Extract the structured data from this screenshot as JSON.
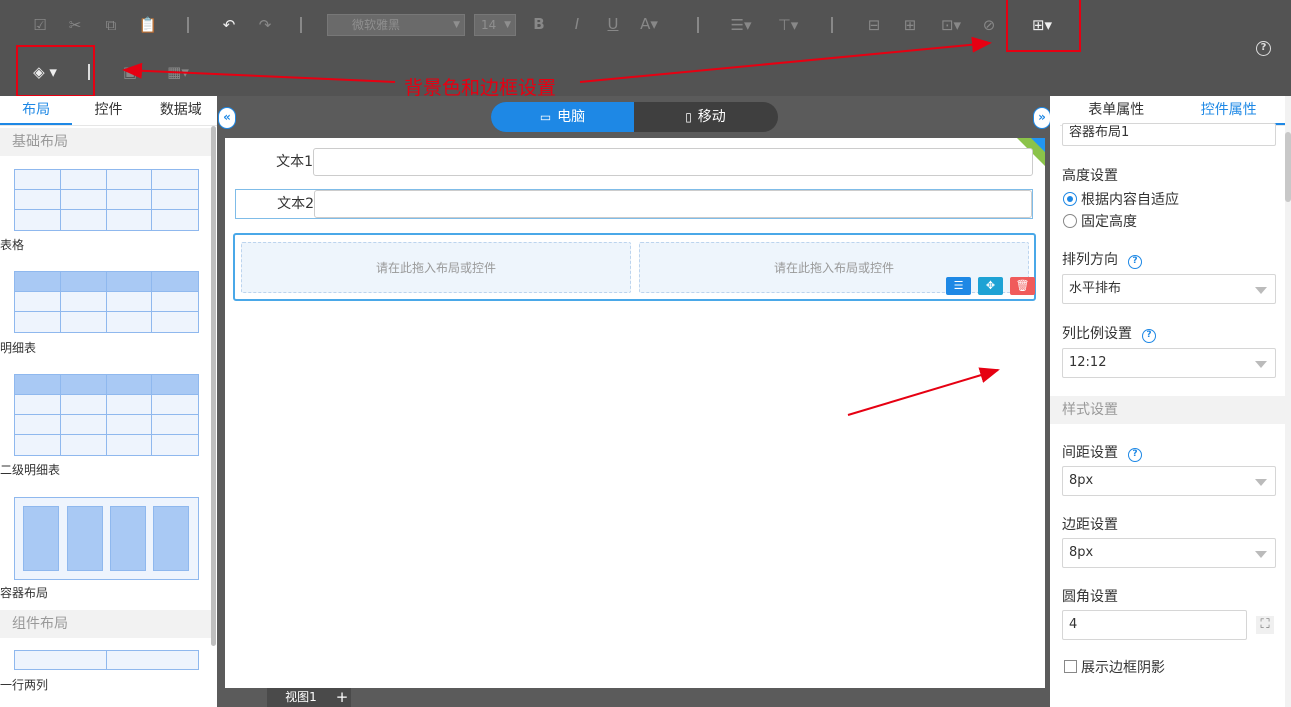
{
  "toolbar": {
    "font_name": "微软雅黑",
    "font_size": "14",
    "icons": [
      "checkbox-icon",
      "cut-icon",
      "copy-icon",
      "paste-icon",
      "undo-icon",
      "redo-icon",
      "bold-icon",
      "italic-icon",
      "underline-icon",
      "font-color-icon",
      "align-icon",
      "valign-icon",
      "merge-icon",
      "split-icon",
      "insert-icon",
      "clear-icon",
      "border-icon",
      "fill-color-icon",
      "image-icon",
      "insert-table-icon",
      "help-icon"
    ]
  },
  "annotations": {
    "bg_border": "背景色和边框设置",
    "basic_style": "基础布局设置和样式设置"
  },
  "left_panel": {
    "tabs": [
      {
        "label": "布局",
        "active": true
      },
      {
        "label": "控件",
        "active": false
      },
      {
        "label": "数据域",
        "active": false
      }
    ],
    "section_basic": "基础布局",
    "items": [
      {
        "label": "表格"
      },
      {
        "label": "明细表"
      },
      {
        "label": "二级明细表"
      },
      {
        "label": "容器布局"
      }
    ],
    "section_component": "组件布局",
    "component_items": [
      {
        "label": "一行两列"
      }
    ]
  },
  "view_toggle": {
    "desktop": "电脑",
    "mobile": "移动",
    "active": "desktop"
  },
  "canvas": {
    "fields": [
      {
        "label": "文本1",
        "value": ""
      },
      {
        "label": "文本2",
        "value": ""
      }
    ],
    "drop_hint_left": "请在此拖入布局或控件",
    "drop_hint_right": "请在此拖入布局或控件"
  },
  "bottom": {
    "view_tab": "视图1",
    "add": "+"
  },
  "right_panel": {
    "tabs": [
      {
        "label": "表单属性",
        "active": false
      },
      {
        "label": "控件属性",
        "active": true
      }
    ],
    "name_value": "容器布局1",
    "height_label": "高度设置",
    "height_options": [
      {
        "label": "根据内容自适应",
        "checked": true
      },
      {
        "label": "固定高度",
        "checked": false
      }
    ],
    "direction_label": "排列方向",
    "direction_value": "水平排布",
    "ratio_label": "列比例设置",
    "ratio_value": "12:12",
    "style_section": "样式设置",
    "gap_label": "间距设置",
    "gap_value": "8px",
    "margin_label": "边距设置",
    "margin_value": "8px",
    "radius_label": "圆角设置",
    "radius_value": "4",
    "shadow_label": "展示边框阴影",
    "shadow_checked": false
  },
  "colors": {
    "accent": "#1e88e5",
    "annotation_red": "#e60012",
    "toolbar_bg": "#535353"
  }
}
